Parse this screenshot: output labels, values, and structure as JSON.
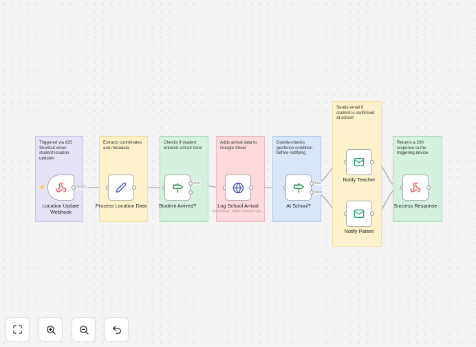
{
  "notes": {
    "webhook": "Triggered via iOS Shortcut when student location updates",
    "process": "Extracts coordinates and metadata",
    "arrived": "Checks if student entered school zone",
    "log": "Adds arrival data to Google Sheet",
    "at_school": "Double-checks geofence condition before notifying",
    "email": "Sends email if student is confirmed at school",
    "response": "Returns a 200 response to the triggering device"
  },
  "nodes": {
    "webhook": {
      "label": "Location Update Webhook",
      "icon": "webhook-icon"
    },
    "process": {
      "label": "Process Location Data",
      "icon": "pencil-icon"
    },
    "arrived": {
      "label": "Student Arrived?",
      "icon": "signpost-icon"
    },
    "log": {
      "label": "Log School Arrival",
      "sublabel": "undefined: https://sheets.go...",
      "icon": "globe-icon"
    },
    "at_school": {
      "label": "At School?",
      "icon": "signpost-icon"
    },
    "notify_teacher": {
      "label": "Notify Teacher",
      "icon": "mail-icon"
    },
    "notify_parent": {
      "label": "Notify Parent",
      "icon": "mail-icon"
    },
    "response": {
      "label": "Success Response",
      "icon": "webhook-icon"
    }
  },
  "edge_labels": {
    "webhook_out": "POST",
    "arrived_true": "true",
    "at_school_true": "true",
    "at_school_false": "false"
  },
  "colors": {
    "webhook_icon": "#e0565b",
    "pencil_icon": "#3b4bb0",
    "signpost_icon": "#1f8a4c",
    "globe_icon": "#3b4bb0",
    "mail_icon": "#27a26b",
    "trigger_bolt": "#ff5a5a"
  },
  "controls": {
    "fit": "Fit view",
    "zoom_in": "Zoom in",
    "zoom_out": "Zoom out",
    "undo": "Undo"
  }
}
